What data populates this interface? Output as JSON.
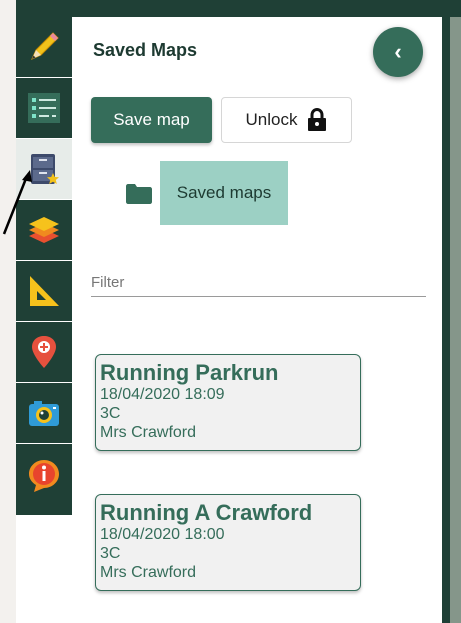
{
  "panel": {
    "title": "Saved Maps",
    "save_label": "Save map",
    "unlock_label": "Unlock",
    "folder_label": "Saved maps",
    "filter_placeholder": "Filter",
    "maps": [
      {
        "name": "Running Parkrun",
        "date": "18/04/2020 18:09",
        "group": "3C",
        "owner": "Mrs Crawford"
      },
      {
        "name": "Running A Crawford",
        "date": "18/04/2020 18:00",
        "group": "3C",
        "owner": "Mrs Crawford"
      }
    ]
  },
  "toolbar": {
    "tools": [
      {
        "icon": "pencil-icon"
      },
      {
        "icon": "list-icon"
      },
      {
        "icon": "saved-maps-icon",
        "active": true
      },
      {
        "icon": "layers-icon"
      },
      {
        "icon": "set-square-icon"
      },
      {
        "icon": "map-pin-icon"
      },
      {
        "icon": "camera-icon"
      },
      {
        "icon": "info-icon"
      }
    ]
  },
  "colors": {
    "toolbar_bg": "#1f4036",
    "accent": "#356d5a",
    "folder_chip": "#9cd0c4"
  }
}
